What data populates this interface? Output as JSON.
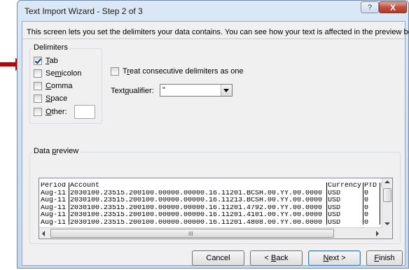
{
  "window": {
    "title": "Text Import Wizard - Step 2 of 3",
    "help_glyph": "?",
    "close_glyph": "X"
  },
  "intro_text": "This screen lets you set the delimiters your data contains.  You can see how your text is affected in the preview below.",
  "delimiters": {
    "label": "Delimiters",
    "tab": {
      "pre": "",
      "key": "T",
      "post": "ab",
      "checked": true
    },
    "semicolon": {
      "pre": "Se",
      "key": "m",
      "post": "icolon",
      "checked": false
    },
    "comma": {
      "pre": "",
      "key": "C",
      "post": "omma",
      "checked": false
    },
    "space": {
      "pre": "",
      "key": "S",
      "post": "pace",
      "checked": false
    },
    "other": {
      "pre": "",
      "key": "O",
      "post": "ther:",
      "checked": false,
      "value": ""
    }
  },
  "consecutive": {
    "pre": "T",
    "key": "r",
    "post": "eat consecutive delimiters as one",
    "checked": false
  },
  "text_qualifier": {
    "pre": "Text ",
    "key": "q",
    "post": "ualifier:",
    "value": "\""
  },
  "data_preview": {
    "pre": "Data ",
    "key": "p",
    "post": "review",
    "scroll_grip": "III",
    "columns": [
      "Period",
      "Account",
      "Currency",
      "PTD",
      "PT"
    ],
    "rows": [
      [
        "Aug-11",
        "2030100.23515.200100.00000.00000.16.11201.BCSH.00.YY.00.0000",
        "USD",
        "0",
        ""
      ],
      [
        "Aug-11",
        "2030100.23515.200100.00000.00000.16.11213.BCSH.00.YY.00.0000",
        "USD",
        "0",
        ""
      ],
      [
        "Aug-11",
        "2030100.23515.200100.00000.00000.16.11201.4792.00.YY.00.0000",
        "USD",
        "0",
        ""
      ],
      [
        "Aug-11",
        "2030100.23515.200100.00000.00000.16.11201.4101.00.YY.00.0000",
        "USD",
        "0",
        ""
      ],
      [
        "Aug-11",
        "2030100.23515.200100.00000.00000.16.11201.4808.00.YY.00.0000",
        "USD",
        "0",
        ""
      ]
    ]
  },
  "buttons": {
    "cancel": "Cancel",
    "back": {
      "pre": "< ",
      "key": "B",
      "post": "ack"
    },
    "next": {
      "pre": "",
      "key": "N",
      "post": "ext >"
    },
    "finish": {
      "pre": "",
      "key": "F",
      "post": "inish"
    }
  },
  "colors": {
    "annotation_arrow": "#c00000",
    "title_bar": "#c5d8ec"
  }
}
